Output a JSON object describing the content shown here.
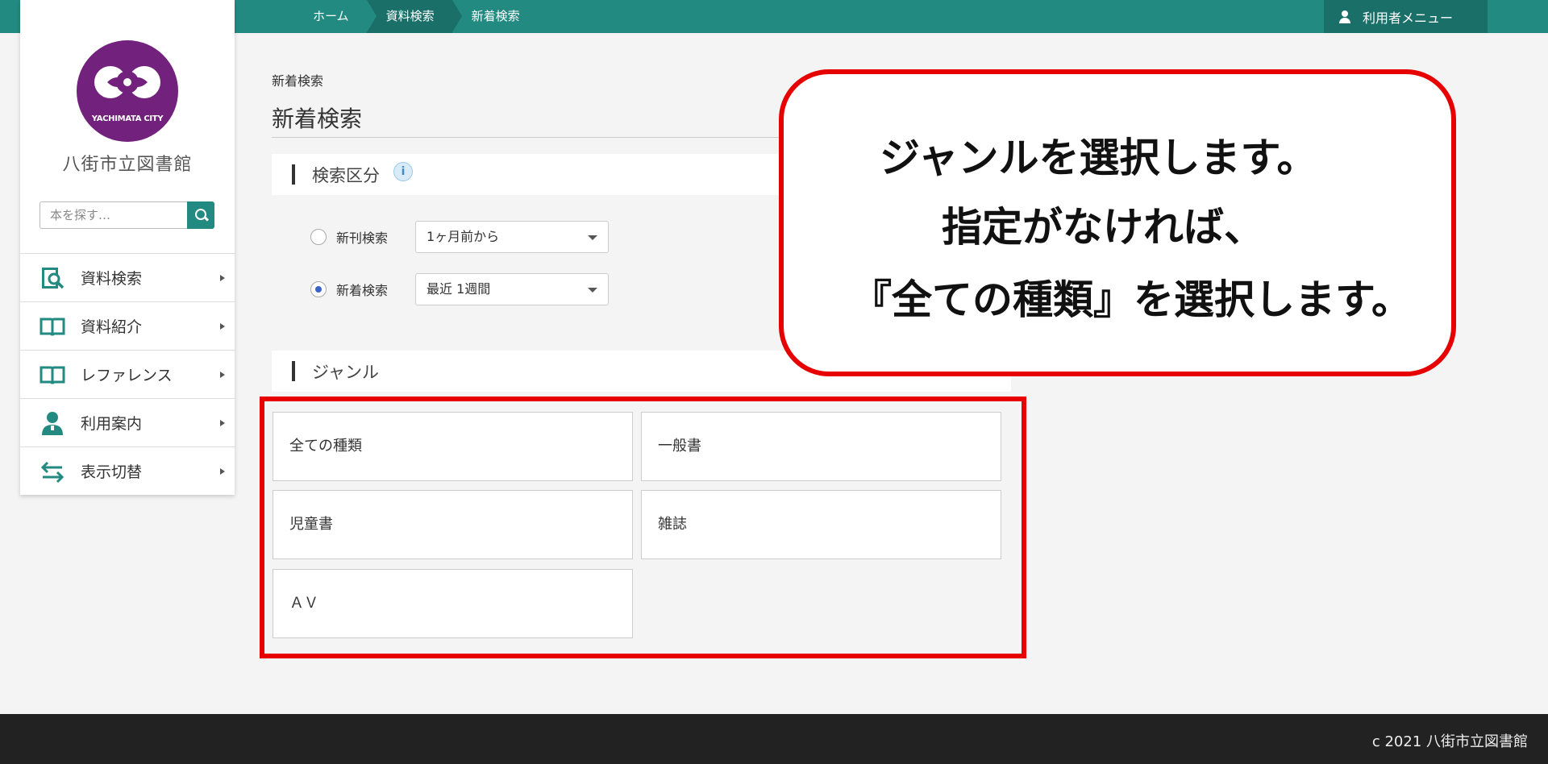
{
  "topbar": {
    "breadcrumb": [
      "ホーム",
      "資料検索",
      "新着検索"
    ],
    "user_menu_label": "利用者メニュー"
  },
  "sidebar": {
    "logo_text": "YACHIMATA CITY",
    "library_name": "八街市立図書館",
    "search_placeholder": "本を探す…",
    "nav_items": [
      {
        "label": "資料検索",
        "icon": "book-search-icon"
      },
      {
        "label": "資料紹介",
        "icon": "open-book-icon"
      },
      {
        "label": "レファレンス",
        "icon": "open-book-icon"
      },
      {
        "label": "利用案内",
        "icon": "librarian-icon"
      },
      {
        "label": "表示切替",
        "icon": "switch-arrows-icon"
      }
    ]
  },
  "main": {
    "sub_title": "新着検索",
    "page_title": "新着検索",
    "search_section": {
      "label": "検索区分",
      "info_icon": "i",
      "options": [
        {
          "label": "新刊検索",
          "selected_value": "1ヶ月前から",
          "checked": false
        },
        {
          "label": "新着検索",
          "selected_value": "最近 1週間",
          "checked": true
        }
      ]
    },
    "genre_section": {
      "label": "ジャンル",
      "genres": [
        "全ての種類",
        "一般書",
        "児童書",
        "雑誌",
        "ＡＶ"
      ]
    }
  },
  "callout": {
    "lines": [
      "ジャンルを選択します。",
      "指定がなければ、",
      "『全ての種類』を選択します。"
    ],
    "border_color": "#e60000"
  },
  "footer": {
    "copyright": "c 2021 八街市立図書館"
  },
  "colors": {
    "brand": "#228a81",
    "brand_dark": "#1a6f68",
    "logo_purple": "#72217d",
    "highlight_red": "#e60000"
  }
}
